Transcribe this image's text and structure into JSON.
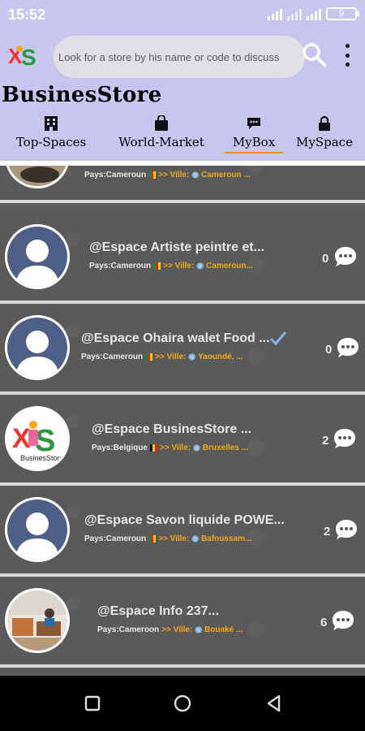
{
  "status": {
    "time": "15:52",
    "battery": "9"
  },
  "search": {
    "placeholder": "Look for a store by his name or code to discuss"
  },
  "brand": "BusinesStore",
  "tabs": [
    {
      "label": "Top-Spaces",
      "icon": "building-icon"
    },
    {
      "label": "World-Market",
      "icon": "shopping-bag-icon"
    },
    {
      "label": "MyBox",
      "icon": "chat-bubble-icon",
      "active": true
    },
    {
      "label": "MySpace",
      "icon": "lock-icon"
    }
  ],
  "stores": [
    {
      "name": "",
      "pays": "Pays:Cameroun",
      "ville": ">> Ville: ",
      "city": "Cameroun ...",
      "count": "",
      "avatar": "photo-avatar"
    },
    {
      "name": "@Espace Artiste peintre et...",
      "pays": "Pays:Cameroun",
      "ville": ">> Ville: ",
      "city": "Cameroun...",
      "count": "0",
      "avatar": "default-avatar"
    },
    {
      "name": "@Espace Ohaira walet Food ...",
      "pays": "Pays:Cameroun",
      "ville": ">> Ville: ",
      "city": "Yaoundé, ...",
      "count": "0",
      "avatar": "default-avatar"
    },
    {
      "name": "@Espace BusinesStore ...",
      "pays": "Pays:Belgique",
      "ville": ">> Ville: ",
      "city": "Bruxelles ...",
      "count": "2",
      "avatar": "businesstore-logo-avatar"
    },
    {
      "name": "@Espace Savon liquide POWE...",
      "pays": "Pays:Cameroun",
      "ville": ">> Ville: ",
      "city": "Bafoussam...",
      "count": "2",
      "avatar": "default-avatar"
    },
    {
      "name": "@Espace Info 237...",
      "pays": "Pays:Cameroon",
      "ville": ">> Ville: ",
      "city": "Bouaké ...",
      "count": "6",
      "avatar": "office-photo-avatar"
    }
  ],
  "colors": {
    "appbar": "#c8c6ef",
    "accent": "#e98b2a",
    "ville": "#f2a818",
    "row": "#5a5a5a"
  }
}
